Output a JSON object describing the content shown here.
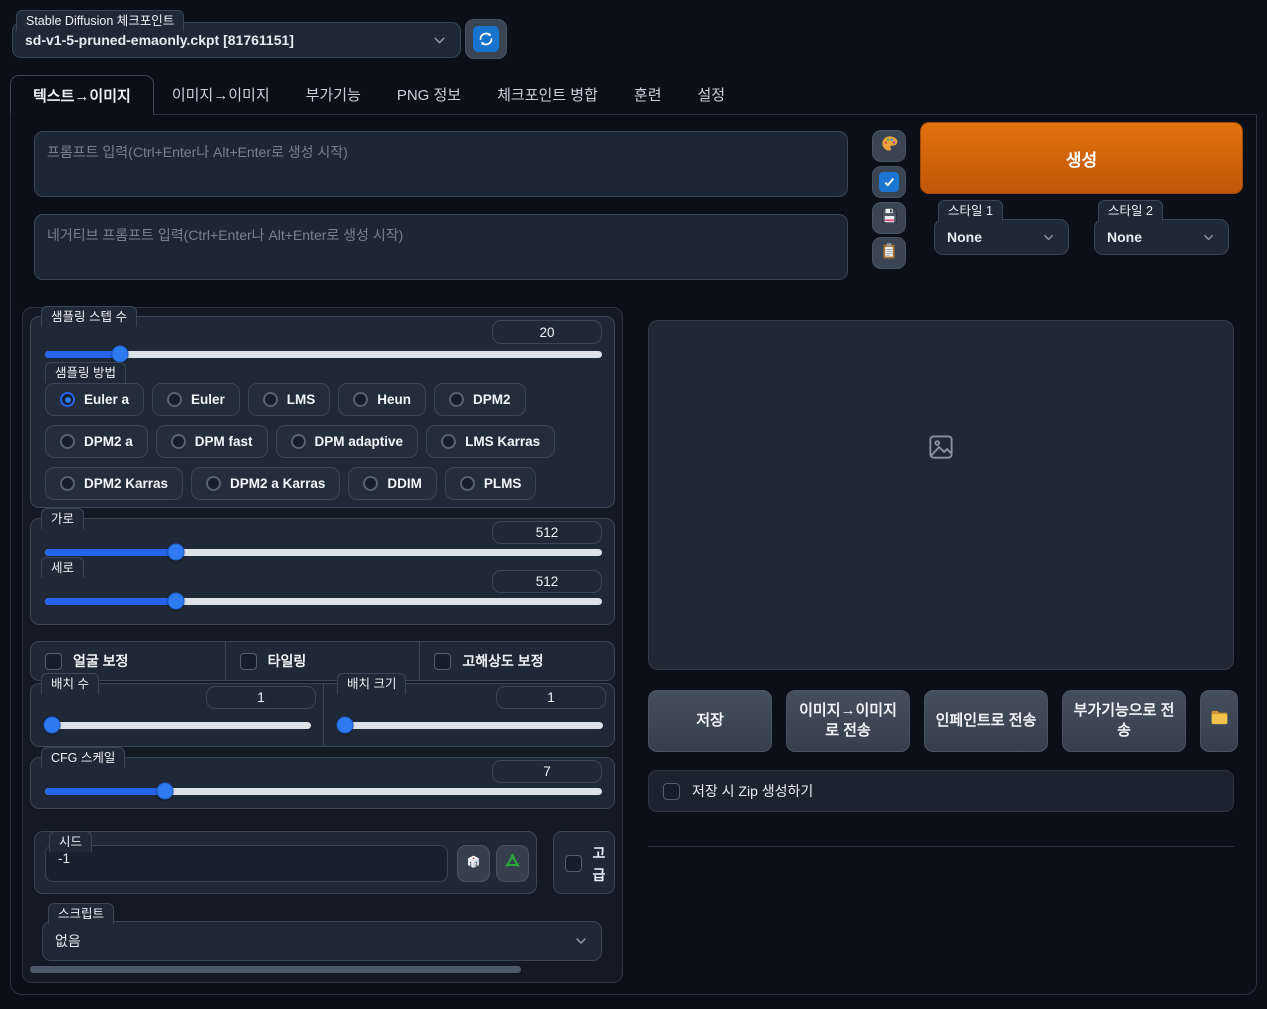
{
  "checkpoint": {
    "label": "Stable Diffusion 체크포인트",
    "value": "sd-v1-5-pruned-emaonly.ckpt [81761151]"
  },
  "tabs": [
    {
      "label": "텍스트→이미지",
      "active": true
    },
    {
      "label": "이미지→이미지",
      "active": false
    },
    {
      "label": "부가기능",
      "active": false
    },
    {
      "label": "PNG 정보",
      "active": false
    },
    {
      "label": "체크포인트 병합",
      "active": false
    },
    {
      "label": "훈련",
      "active": false
    },
    {
      "label": "설정",
      "active": false
    }
  ],
  "prompts": {
    "positive_placeholder": "프롬프트 입력(Ctrl+Enter나 Alt+Enter로 생성 시작)",
    "negative_placeholder": "네거티브 프롬프트 입력(Ctrl+Enter나 Alt+Enter로 생성 시작)"
  },
  "generate": {
    "label": "생성"
  },
  "styles": {
    "style1_label": "스타일 1",
    "style1_value": "None",
    "style2_label": "스타일 2",
    "style2_value": "None"
  },
  "sampling": {
    "steps_label": "샘플링 스텝 수",
    "steps_value": "20",
    "method_label": "샘플링 방법",
    "methods": [
      {
        "label": "Euler a",
        "selected": true
      },
      {
        "label": "Euler",
        "selected": false
      },
      {
        "label": "LMS",
        "selected": false
      },
      {
        "label": "Heun",
        "selected": false
      },
      {
        "label": "DPM2",
        "selected": false
      },
      {
        "label": "DPM2 a",
        "selected": false
      },
      {
        "label": "DPM fast",
        "selected": false
      },
      {
        "label": "DPM adaptive",
        "selected": false
      },
      {
        "label": "LMS Karras",
        "selected": false
      },
      {
        "label": "DPM2 Karras",
        "selected": false
      },
      {
        "label": "DPM2 a Karras",
        "selected": false
      },
      {
        "label": "DDIM",
        "selected": false
      },
      {
        "label": "PLMS",
        "selected": false
      }
    ]
  },
  "dimensions": {
    "width_label": "가로",
    "width_value": "512",
    "height_label": "세로",
    "height_value": "512"
  },
  "toggles": {
    "restore_faces_label": "얼굴 보정",
    "tiling_label": "타일링",
    "highres_fix_label": "고해상도 보정"
  },
  "batch": {
    "count_label": "배치 수",
    "count_value": "1",
    "size_label": "배치 크기",
    "size_value": "1"
  },
  "cfg": {
    "label": "CFG 스케일",
    "value": "7"
  },
  "seed": {
    "label": "시드",
    "value": "-1",
    "advanced_label": "고급"
  },
  "script": {
    "label": "스크립트",
    "value": "없음"
  },
  "output": {
    "save_label": "저장",
    "send_img2img_label": "이미지→이미지로 전송",
    "send_inpaint_label": "인페인트로 전송",
    "send_extras_label": "부가기능으로 전송",
    "zip_label": "저장 시 Zip 생성하기"
  },
  "colors": {
    "accent_orange": "#c9600e",
    "accent_blue": "#2563eb",
    "slider_track": "#dde2e9"
  }
}
